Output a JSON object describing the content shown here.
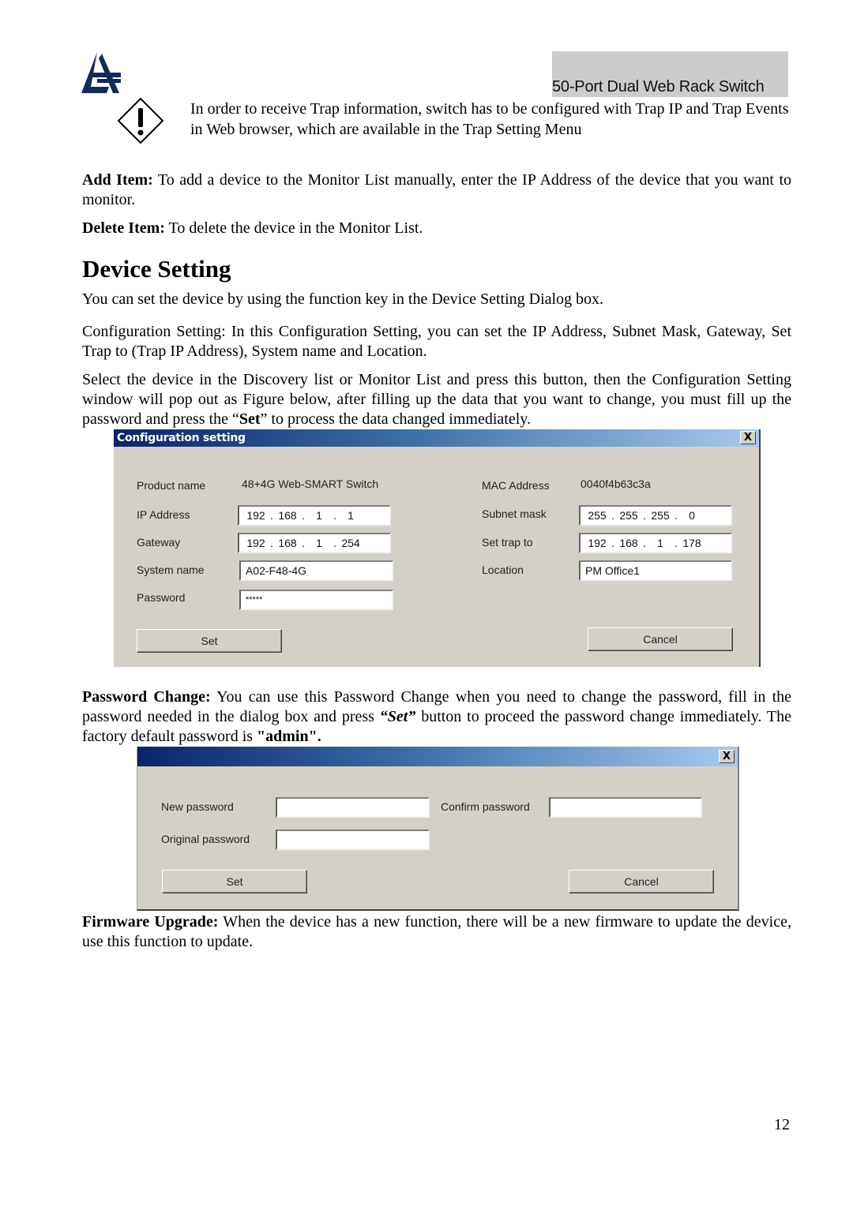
{
  "header": {
    "logo": "atlantis-logo-icon",
    "title": "50-Port Dual Web Rack Switch"
  },
  "warning": {
    "icon": "warning-diamond-icon",
    "text": "In order to receive Trap information, switch has to be configured with Trap IP and Trap Events in Web browser, which are available in the Trap Setting Menu"
  },
  "add_item": {
    "label": "Add Item:",
    "text": " To add a device to the Monitor List manually, enter the IP Address of the device that you want to monitor."
  },
  "delete_item": {
    "label": "Delete Item:",
    "text": " To delete the device in the Monitor List."
  },
  "section": {
    "heading": "Device Setting",
    "intro": "You can set the device by using the function key in the Device Setting Dialog box.",
    "config_para": "Configuration Setting: In this Configuration Setting, you can set the IP Address, Subnet Mask, Gateway, Set Trap to (Trap IP Address), System name and Location.",
    "select_para_1": "Select the device in the Discovery list or Monitor List and press this button, then the Configuration Setting window will pop out as Figure below, after filling up the data that you want to change, you must fill up the password and press the “",
    "select_para_set": "Set",
    "select_para_2": "” to process the data changed immediately."
  },
  "config_dialog": {
    "title": "Configuration setting",
    "close": "X",
    "product_name_label": "Product name",
    "product_name_value": "48+4G Web-SMART Switch",
    "mac_label": "MAC Address",
    "mac_value": "0040f4b63c3a",
    "ip_label": "IP Address",
    "ip_value": [
      "192",
      "168",
      "1",
      "1"
    ],
    "subnet_label": "Subnet mask",
    "subnet_value": [
      "255",
      "255",
      "255",
      "0"
    ],
    "gateway_label": "Gateway",
    "gateway_value": [
      "192",
      "168",
      "1",
      "254"
    ],
    "trap_label": "Set trap to",
    "trap_value": [
      "192",
      "168",
      "1",
      "178"
    ],
    "sysname_label": "System name",
    "sysname_value": "A02-F48-4G",
    "location_label": "Location",
    "location_value": "PM Office1",
    "password_label": "Password",
    "password_value": "*****",
    "set_button": "Set",
    "cancel_button": "Cancel"
  },
  "password_change": {
    "label": "Password Change:",
    "text_1": " You can use this Password Change when you need to change the password, fill in the password needed in the dialog box and press ",
    "set_word": "“Set”",
    "text_2": " button to proceed the password change immediately. The factory default password is ",
    "default_pw": "\"admin\"."
  },
  "password_dialog": {
    "close": "X",
    "new_label": "New password",
    "new_value": "",
    "confirm_label": "Confirm password",
    "confirm_value": "",
    "original_label": "Original password",
    "original_value": "",
    "set_button": "Set",
    "cancel_button": "Cancel"
  },
  "firmware": {
    "label": "Firmware Upgrade:",
    "text": " When the device has a new function, there will be a new firmware to update the device, use this function to update."
  },
  "page_number": "12"
}
